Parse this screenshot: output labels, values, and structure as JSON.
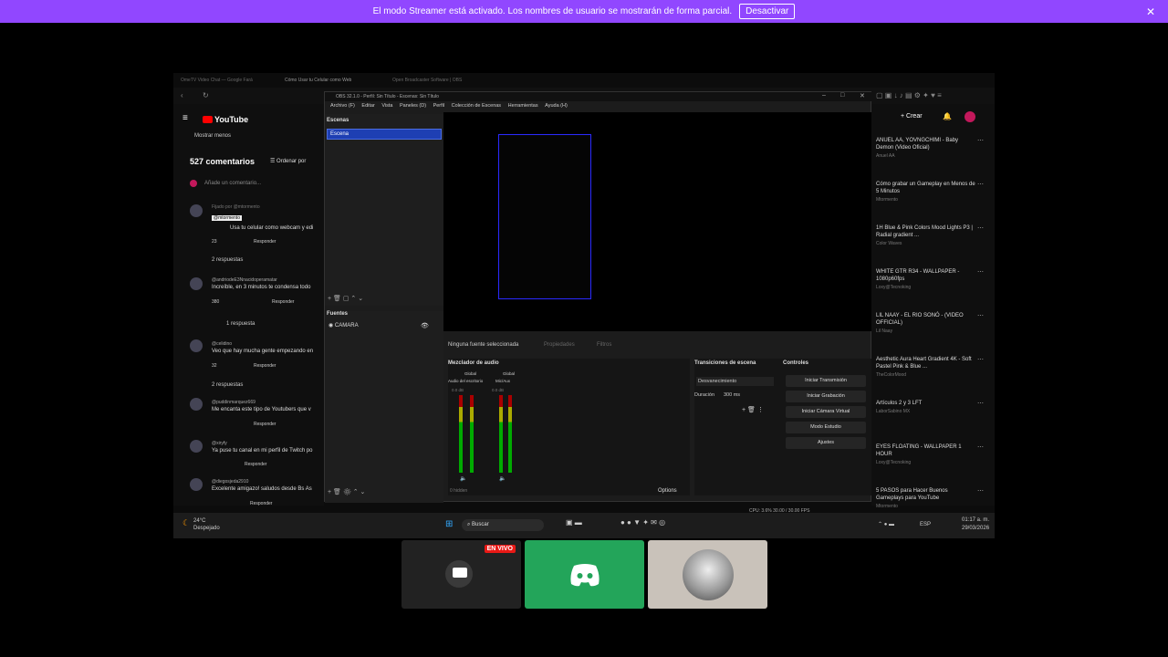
{
  "banner": {
    "text": "El modo Streamer está activado. Los nombres de usuario se mostrarán de forma parcial.",
    "button": "Desactivar"
  },
  "browser": {
    "tabs": [
      "OmeTV Video Chat — Google Fará",
      "Cómo Usar tu Celular como Web",
      "Open Broadcaster Software | OBS"
    ]
  },
  "youtube": {
    "logo": "YouTube",
    "show_less": "Mostrar menos",
    "comment_count": "527 comentarios",
    "sort": "Ordenar por",
    "add_comment": "Añade un comentario...",
    "pinned": "Fijado por @mtormento",
    "comments": [
      {
        "user": "@mtormento",
        "time": "hace 8 meses",
        "text": "Usa tu celular como webcam y edi",
        "likes": "23",
        "reply": "Responder"
      },
      {
        "user": "@andriodeE3Nnacidoperamatar",
        "time": "hace 1 año",
        "text": "Increíble, en 3 minutos te condensa todo",
        "likes": "380",
        "reply": "Responder"
      },
      {
        "user": "@celidino",
        "time": "hace 1 mes",
        "text": "Veo que hay mucha gente empezando en",
        "likes": "32",
        "reply": "Responder"
      },
      {
        "user": "@puddinmarquez669",
        "time": "hace 11 meses (editado)",
        "text": "Me encanta este tipo de Youtubers que v",
        "likes": "",
        "reply": "Responder"
      },
      {
        "user": "@xiryfy",
        "time": "hace 1 año",
        "text": "Ya puse tu canal en mi perfil de Twitch po",
        "likes": "",
        "reply": "Responder"
      },
      {
        "user": "@diegosjeda2910",
        "time": "hace 1 mes",
        "text": "Excelente amigazo! saludos desde Bs As",
        "likes": "",
        "reply": "Responder"
      }
    ],
    "replies": [
      "2 respuestas",
      "1 respuesta",
      "2 respuestas"
    ]
  },
  "obs": {
    "title": "OBS 32.1.0 - Perfil: Sin Título - Escenas: Sin Título",
    "menu": [
      "Archivo (F)",
      "Editar",
      "Vista",
      "Paneles (D)",
      "Perfil",
      "Colección de Escenas",
      "Herramientas",
      "Ayuda (H)"
    ],
    "scenes_header": "Escenas",
    "scene": "Escena",
    "sources_header": "Fuentes",
    "source": "CAMARA",
    "no_source": "Ninguna fuente seleccionada",
    "properties": "Propiedades",
    "filters": "Filtros",
    "mixer_header": "Mezclador de audio",
    "global": "Global",
    "track1": "Audio del escritorio",
    "track2": "Mic/Aux",
    "db": "0.0 dB",
    "hidden": "0 hidden",
    "options": "Options",
    "trans_header": "Transiciones de escena",
    "trans_type": "Desvanecimiento",
    "duration_label": "Duración",
    "duration": "300 ms",
    "controls_header": "Controles",
    "controls": [
      "Iniciar Transmisión",
      "Iniciar Grabación",
      "Iniciar Cámara Virtual",
      "Modo Estudio",
      "Ajustes"
    ],
    "status": "CPU: 3.6%   30.00 / 30.00 FPS"
  },
  "sidebar": {
    "create": "Crear",
    "videos": [
      {
        "title": "ANUEL AA, YOVNGCHIMI - Baby Demon (Video Oficial)",
        "meta": "Anuel AA"
      },
      {
        "title": "Cómo grabar un Gameplay en Menos de 5 Minutos",
        "meta": "Mtormento"
      },
      {
        "title": "1H Blue & Pink Colors Mood Lights P3 | Radial gradient ...",
        "meta": "Color Waves"
      },
      {
        "title": "WHITE GTR R34 - WALLPAPER - 1080p60fps",
        "meta": "Loxy@Tecnoking"
      },
      {
        "title": "LIL NAAY - EL RIO SONÓ - (VIDEO OFFICIAL)",
        "meta": "Lil Naay"
      },
      {
        "title": "Aesthetic Aura Heart Gradient 4K - Soft Pastel Pink & Blue ...",
        "meta": "TheColorMood"
      },
      {
        "title": "Artículos 2 y 3 LFT",
        "meta": "LaborSabino MX"
      },
      {
        "title": "EYES FLOATING - WALLPAPER 1 HOUR",
        "meta": "Loxy@Tecnoking"
      },
      {
        "title": "5 PASOS para Hacer Buenos Gameplays para YouTube",
        "meta": "Mtormento"
      }
    ]
  },
  "taskbar": {
    "temp": "24°C",
    "weather": "Despejado",
    "search": "Buscar",
    "lang": "ESP",
    "time": "01:17 a. m.",
    "date": "29/03/2026"
  },
  "live_badge": "EN VIVO"
}
